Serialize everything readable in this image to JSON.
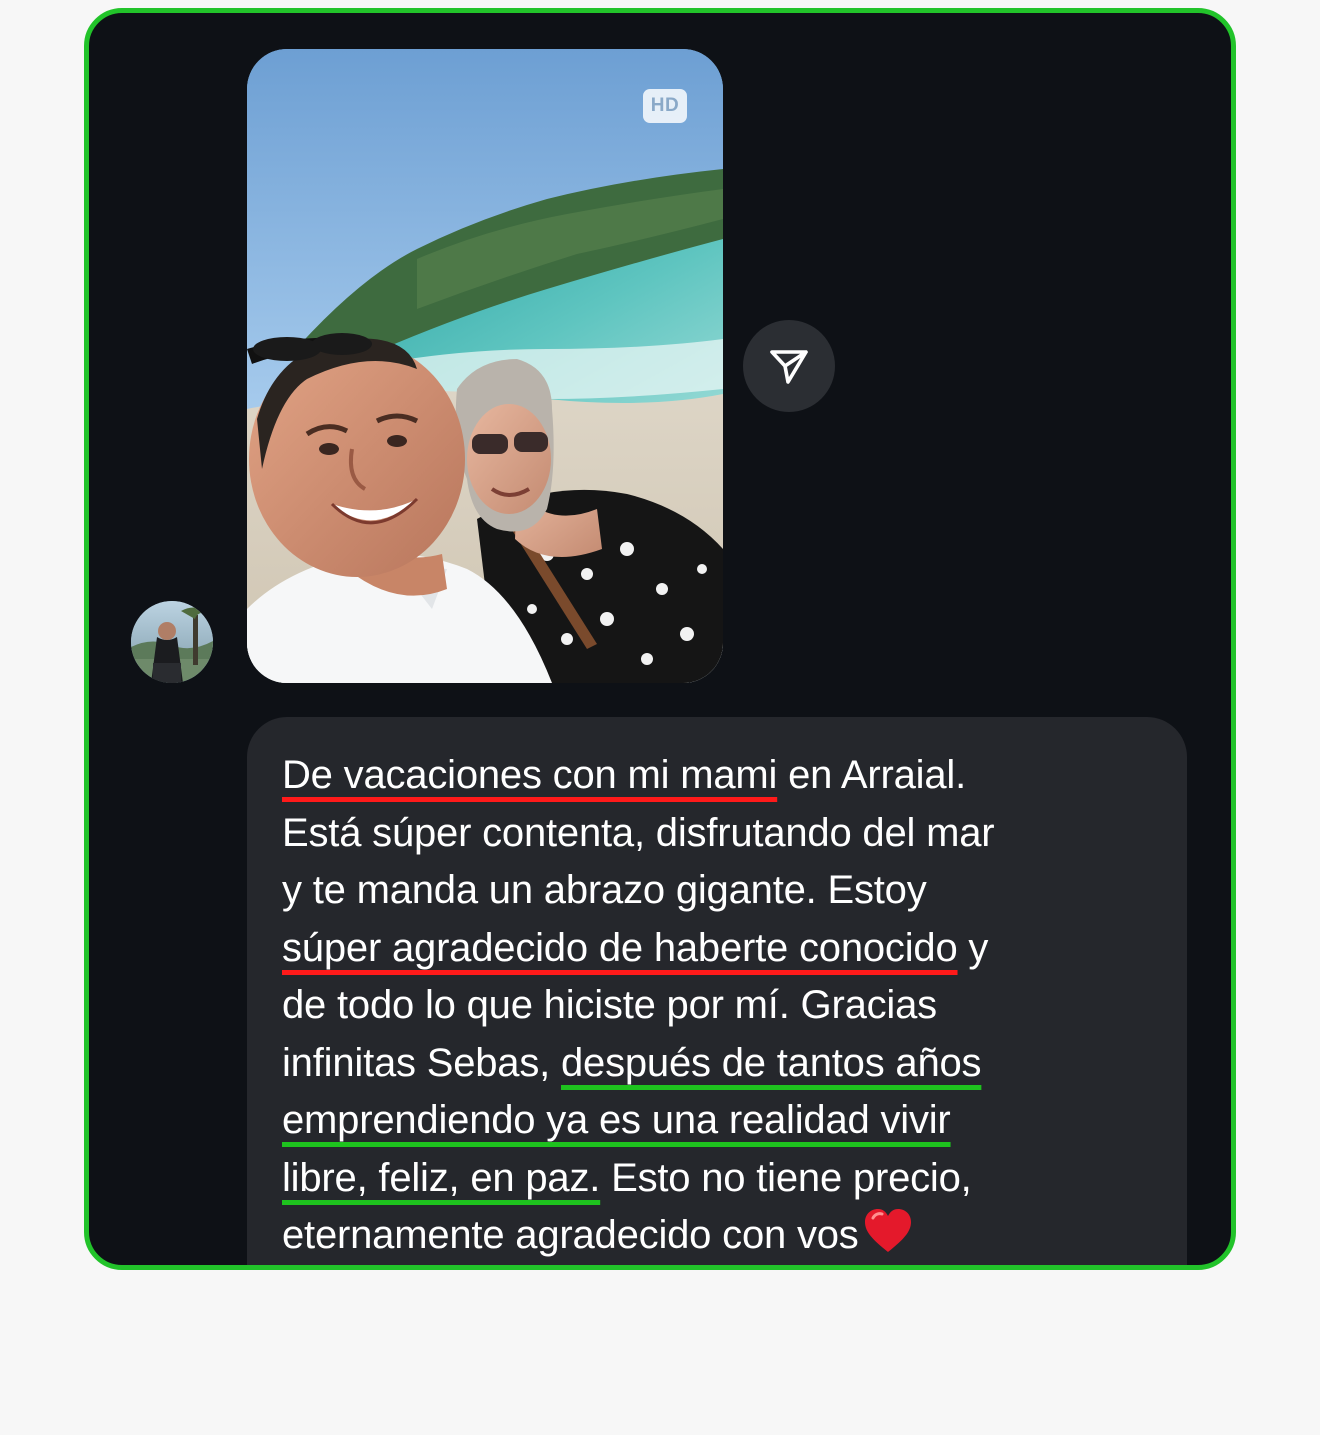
{
  "accent_color": "#22c32a",
  "chat": {
    "sender_avatar": {
      "icon": "avatar-photo"
    },
    "photo_message": {
      "hd_badge": "HD"
    },
    "share_button": {
      "icon": "paper-plane-icon"
    },
    "text_message": {
      "lines": [
        [
          {
            "text": "De vacaciones con mi mami",
            "mark": "red"
          },
          {
            "text": " en Arraial.",
            "mark": ""
          }
        ],
        [
          {
            "text": "Está súper contenta, disfrutando del mar",
            "mark": ""
          }
        ],
        [
          {
            "text": "y te manda un abrazo gigante. Estoy",
            "mark": ""
          }
        ],
        [
          {
            "text": "súper agradecido de haberte conocido",
            "mark": "red"
          },
          {
            "text": " y",
            "mark": ""
          }
        ],
        [
          {
            "text": "de todo lo que hiciste por mí. Gracias",
            "mark": ""
          }
        ],
        [
          {
            "text": "infinitas Sebas, ",
            "mark": ""
          },
          {
            "text": "después de tantos años",
            "mark": "green"
          }
        ],
        [
          {
            "text": "emprendiendo ya es una realidad vivir",
            "mark": "green"
          }
        ],
        [
          {
            "text": "libre, feliz, en paz.",
            "mark": "green"
          },
          {
            "text": " Esto no tiene precio,",
            "mark": ""
          }
        ],
        [
          {
            "text": "eternamente agradecido con vos",
            "mark": ""
          }
        ]
      ],
      "emoji": "heart-emoji"
    },
    "highlight_colors": {
      "red": "#ff1a1a",
      "green": "#1ec21e"
    }
  }
}
